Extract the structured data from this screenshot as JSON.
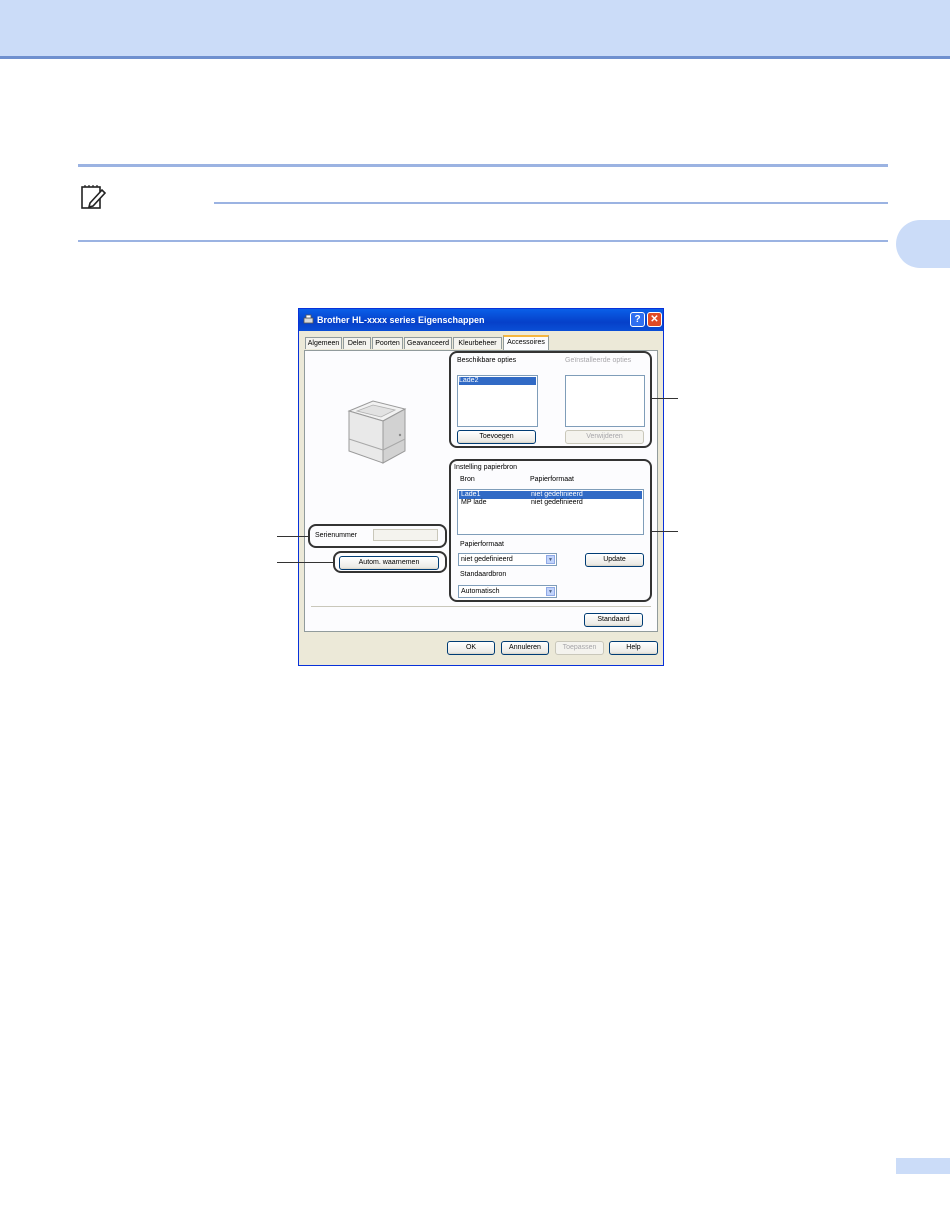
{
  "dialog": {
    "title": "Brother HL-xxxx series Eigenschappen",
    "help_glyph": "?",
    "close_glyph": "✕",
    "tabs": [
      "Algemeen",
      "Delen",
      "Poorten",
      "Geavanceerd",
      "Kleurbeheer",
      "Accessoires"
    ],
    "active_tab": "Accessoires",
    "available_options_label": "Beschikbare opties",
    "installed_options_label": "Geïnstalleerde opties",
    "available_items": [
      "Lade2"
    ],
    "add_button": "Toevoegen",
    "remove_button": "Verwijderen",
    "paper_source_group": "Instelling papierbron",
    "col_source": "Bron",
    "col_paper_size": "Papierformaat",
    "source_rows": [
      {
        "source": "Lade1",
        "size": "niet gedefinieerd"
      },
      {
        "source": "MP lade",
        "size": "niet gedefinieerd"
      }
    ],
    "paper_size_label": "Papierformaat",
    "paper_size_value": "niet gedefinieerd",
    "update_button": "Update",
    "default_source_label": "Standaardbron",
    "default_source_value": "Automatisch",
    "serial_label": "Serienummer",
    "auto_detect_button": "Autom. waarnemen",
    "default_button": "Standaard",
    "ok_button": "OK",
    "cancel_button": "Annuleren",
    "apply_button": "Toepassen",
    "help_button": "Help"
  },
  "colors": {
    "header_band": "#cbdcf8",
    "rule": "#9bb3e2",
    "titlebar": "#0a5fe8",
    "selection": "#316ac5"
  },
  "icons": {
    "note": "pencil-note-icon",
    "title": "printer-icon"
  }
}
